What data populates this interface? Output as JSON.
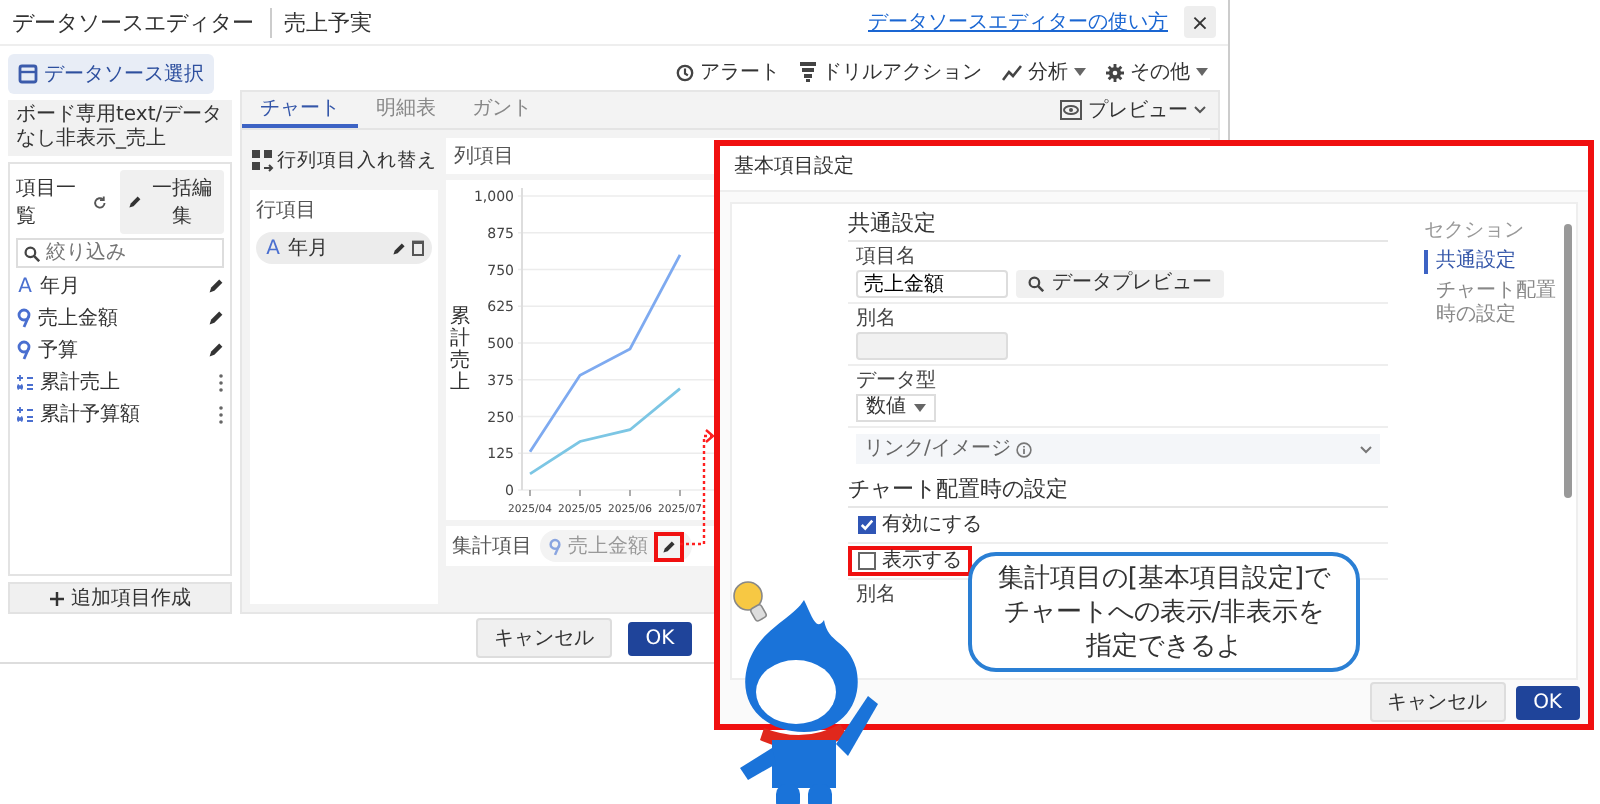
{
  "window": {
    "title": "データソースエディター",
    "subtitle": "売上予実",
    "help_link": "データソースエディターの使い方",
    "close": "×"
  },
  "sidebar": {
    "source_button": "データソース選択",
    "source_name": "ボード専用text/データなし非表示_売上",
    "list_title": "項目一覧",
    "bulk_edit": "一括編集",
    "search": {
      "placeholder": "絞り込み"
    },
    "items": [
      {
        "kind": "text",
        "badge": "A",
        "label": "年月"
      },
      {
        "kind": "number",
        "label": "売上金額"
      },
      {
        "kind": "number",
        "label": "予算"
      },
      {
        "kind": "calc",
        "label": "累計売上"
      },
      {
        "kind": "calc",
        "label": "累計予算額"
      }
    ],
    "add_button": "追加項目作成"
  },
  "toolbar": [
    {
      "kind": "alert",
      "label": "アラート",
      "dropdown": false
    },
    {
      "kind": "drill",
      "label": "ドリルアクション",
      "dropdown": false
    },
    {
      "kind": "analysis",
      "label": "分析",
      "dropdown": true
    },
    {
      "kind": "more",
      "label": "その他",
      "dropdown": true
    }
  ],
  "tabs": [
    {
      "label": "チャート",
      "selected": true
    },
    {
      "label": "明細表",
      "selected": false
    },
    {
      "label": "ガント",
      "selected": false
    }
  ],
  "preview": "プレビュー",
  "swap_button": "行列項目入れ替え",
  "row_items": {
    "label": "行項目",
    "chips": [
      {
        "badge": "A",
        "label": "年月"
      }
    ]
  },
  "column_items": {
    "label": "列項目"
  },
  "chart": {
    "chart_data": {
      "type": "line",
      "grid": true,
      "ylabel": "累計売上",
      "categories": [
        "2025/04",
        "2025/05",
        "2025/06",
        "2025/07"
      ],
      "ylim": [
        0,
        1000
      ],
      "yticks": [
        0,
        125,
        250,
        375,
        500,
        625,
        750,
        875,
        {
          "value": 1000,
          "label": "1,000"
        }
      ],
      "series": [
        {
          "color": "#7eaaf0",
          "values": [
            130,
            390,
            480,
            800
          ]
        },
        {
          "color": "#7cc6e4",
          "values": [
            55,
            165,
            205,
            345
          ]
        }
      ]
    }
  },
  "aggregate_items": {
    "label": "集計項目",
    "chips": [
      {
        "label": "売上金額",
        "highlighted": true
      }
    ]
  },
  "footer": [
    "キャンセル",
    "OK"
  ],
  "dialog": {
    "title": "基本項目設定",
    "sections": [
      {
        "kind": "common",
        "heading": "共通設定",
        "name_label": "項目名",
        "name_value": "売上金額",
        "preview_button": "データプレビュー",
        "alias_label": "別名",
        "type_label": "データ型",
        "type_value": "数値",
        "link_label": "リンク/イメージ"
      },
      {
        "kind": "chart",
        "heading": "チャート配置時の設定",
        "options": [
          {
            "label": "有効にする",
            "checked": true,
            "highlighted": false
          },
          {
            "label": "表示する",
            "checked": false,
            "highlighted": true
          }
        ],
        "alias_label": "別名"
      }
    ],
    "nav_title": "セクション",
    "nav": [
      {
        "label": "共通設定",
        "selected": true
      },
      {
        "label": "チャート配置時の設定",
        "selected": false
      }
    ],
    "buttons": [
      "キャンセル",
      "OK"
    ]
  },
  "callout": {
    "lines": [
      "集計項目の[基本項目設定]で",
      "チャートへの表示/非表示を",
      "指定できるよ"
    ]
  }
}
